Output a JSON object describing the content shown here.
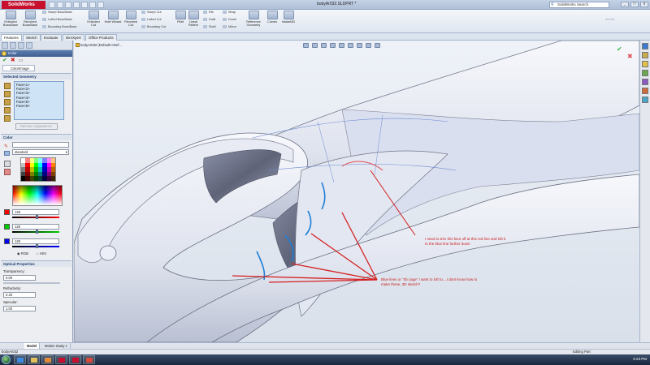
{
  "app": {
    "logo": "SolidWorks",
    "document_title": "bodyAr032.SLDPRT *",
    "search_placeholder": "SolidWorks Search",
    "window_buttons": [
      "_",
      "□",
      "x"
    ]
  },
  "ribbon": {
    "large": [
      {
        "label": "Extruded Boss/Base"
      },
      {
        "label": "Revolved Boss/Base"
      },
      {
        "label": "Extruded Cut"
      },
      {
        "label": "Hole Wizard"
      },
      {
        "label": "Revolved Cut"
      },
      {
        "label": "Fillet"
      },
      {
        "label": "Linear Pattern"
      },
      {
        "label": "Reference Geometry"
      },
      {
        "label": "Curves"
      },
      {
        "label": "Instant3D"
      }
    ],
    "small_col1": [
      "Swept Boss/Base",
      "Lofted Boss/Base",
      "Boundary Boss/Base"
    ],
    "small_col2": [
      "Swept Cut",
      "Lofted Cut",
      "Boundary Cut"
    ],
    "small_col3": [
      "Rib",
      "Draft",
      "Shell"
    ],
    "small_col4": [
      "Wrap",
      "Dome",
      "Mirror"
    ]
  },
  "tabs": [
    "Features",
    "Sketch",
    "Evaluate",
    "DimXpert",
    "Office Products"
  ],
  "active_tab": "Features",
  "property_manager": {
    "title": "Color",
    "tab_label": "Color/Image",
    "selected_geometry_title": "Selected Geometry",
    "faces": [
      "Face<1>",
      "Face<2>",
      "Face<3>",
      "Face<4>",
      "Face<5>",
      "Face<6>"
    ],
    "remove_button": "Remove Appearance",
    "color_section_title": "Color",
    "palette_dropdown": "standard",
    "rgb": [
      {
        "channel": "R",
        "value": "128",
        "color": "#ff0000",
        "level": 0.5
      },
      {
        "channel": "G",
        "value": "128",
        "color": "#00cc00",
        "level": 0.5
      },
      {
        "channel": "B",
        "value": "128",
        "color": "#0000ff",
        "level": 0.5
      }
    ],
    "mode_rgb": "RGB",
    "mode_hsv": "HSV",
    "optical_title": "Optical Properties",
    "transparency_label": "Transparency:",
    "transparency_value": "0.00",
    "refractivity_label": "Refractivity:",
    "refractivity_value": "0.20",
    "specular_label": "Specular:",
    "specular_value": "1.00"
  },
  "viewport": {
    "breadcrumb": "bodyAr032 (Default<<Def..."
  },
  "annotations": {
    "note1": "I need to trim this face off at this red line and loft it to the blue line further down",
    "note2": "Blue lines or \"rib cage\" I want to loft to....I dont know how to make these, 3D sketch?"
  },
  "bottom_tabs": [
    "Model",
    "Motion Study 1"
  ],
  "active_bottom_tab": "Model",
  "status": {
    "left": "bodyAr032",
    "mode": "Editing Part",
    "clock": "6:23 PM"
  }
}
